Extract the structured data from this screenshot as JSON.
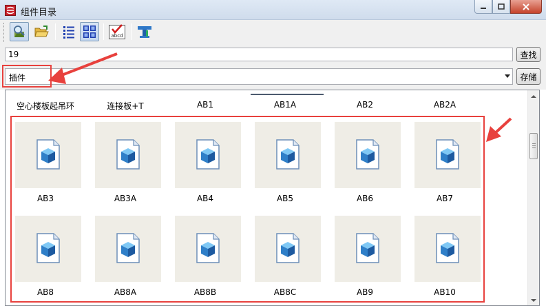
{
  "window": {
    "title": "组件目录",
    "accent": "#e8413d"
  },
  "toolbar": {
    "buttons": [
      {
        "icon": "magnifier-search-icon",
        "pressed": true
      },
      {
        "icon": "open-folder-icon",
        "pressed": false
      },
      {
        "icon": "list-view-icon",
        "pressed": false
      },
      {
        "icon": "thumbnail-view-icon",
        "pressed": true
      },
      {
        "icon": "abcd-checkmark-icon",
        "pressed": false
      },
      {
        "icon": "steel-beam-icon",
        "pressed": false
      }
    ],
    "abcd_text": "abcd"
  },
  "search": {
    "value": "19",
    "button_label": "查找"
  },
  "category": {
    "selected": "插件",
    "save_label": "存储"
  },
  "grid": {
    "header_items": [
      "空心楼板起吊环",
      "连接板+T",
      "AB1",
      "AB1A",
      "AB2",
      "AB2A"
    ],
    "row1": [
      "AB3",
      "AB3A",
      "AB4",
      "AB5",
      "AB6",
      "AB7"
    ],
    "row2": [
      "AB8",
      "AB8A",
      "AB8B",
      "AB8C",
      "AB9",
      "AB10"
    ]
  }
}
